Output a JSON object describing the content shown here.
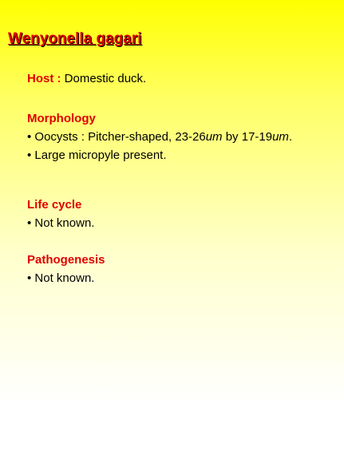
{
  "title": "Wenyonella gagari",
  "host": {
    "label": "Host :",
    "value": " Domestic duck."
  },
  "morphology": {
    "heading": "Morphology",
    "oocyst_text_1": "• Oocysts : Pitcher-shaped, 23-26",
    "unit_1": "um",
    "oocyst_text_2": " by 17-19",
    "unit_2": "um",
    "oocyst_text_3": ".",
    "micropyle": "• Large micropyle present."
  },
  "life_cycle": {
    "heading": "Life cycle",
    "text": "• Not known."
  },
  "pathogenesis": {
    "heading": "Pathogenesis",
    "text": "• Not known."
  },
  "colors": {
    "accent": "#e00000",
    "background_top": "#ffff00",
    "background_bottom": "#ffffff"
  }
}
